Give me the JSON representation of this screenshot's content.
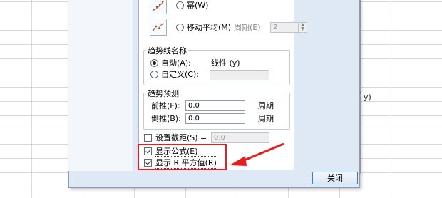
{
  "background": {
    "chart_fragment_text": "y)"
  },
  "trend_types": {
    "power_label": "幂(W)",
    "moving_average_label": "移动平均(M)",
    "period_label": "周期(E):",
    "period_value": "2"
  },
  "trendline_name": {
    "group_title": "趋势线名称",
    "auto_label": "自动(A):",
    "auto_value": "线性 (y)",
    "custom_label": "自定义(C):",
    "custom_value": ""
  },
  "forecast": {
    "group_title": "趋势预测",
    "forward_label": "前推(F):",
    "forward_value": "0.0",
    "forward_unit": "周期",
    "backward_label": "倒推(B):",
    "backward_value": "0.0",
    "backward_unit": "周期"
  },
  "options": {
    "set_intercept_label": "设置截距(S) =",
    "intercept_value": "0.0",
    "show_equation_label": "显示公式(E)",
    "show_equation_checked": true,
    "show_r2_label": "显示 R 平方值(R)",
    "show_r2_checked": true,
    "set_intercept_checked": false
  },
  "buttons": {
    "close_label": "关闭"
  },
  "colors": {
    "highlight": "#e02020",
    "dialog_bg": "#dfe8f5"
  }
}
